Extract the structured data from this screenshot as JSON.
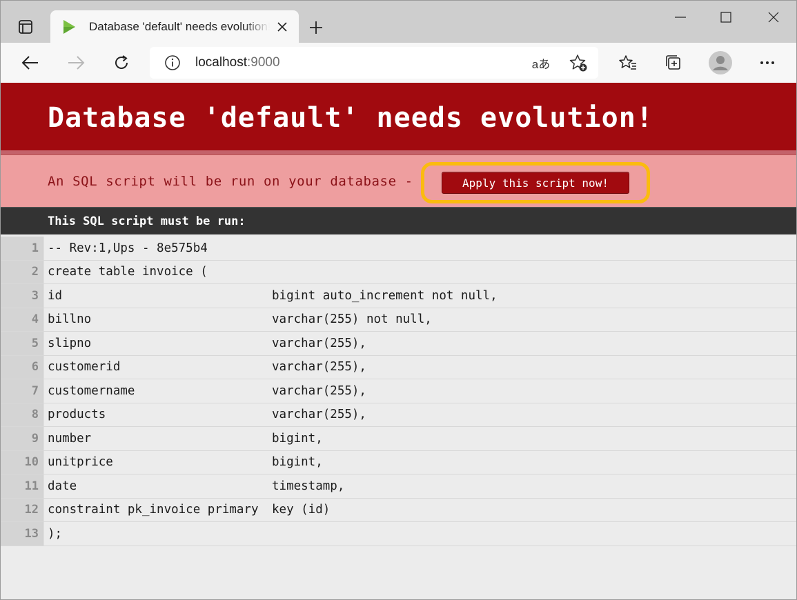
{
  "browser": {
    "tab_title": "Database 'default' needs evolution!",
    "url_host": "localhost",
    "url_port": ":9000",
    "read_aloud_label": "aあ"
  },
  "page": {
    "title": "Database 'default' needs evolution!",
    "subtitle": "An SQL script will be run on your database -",
    "apply_button": "Apply this script now!",
    "script_header": "This SQL script must be run:",
    "lines": [
      {
        "n": "1",
        "a": "-- Rev:1,Ups - 8e575b4",
        "b": ""
      },
      {
        "n": "2",
        "a": "create table invoice (",
        "b": ""
      },
      {
        "n": "3",
        "a": "id",
        "b": "bigint auto_increment not null,"
      },
      {
        "n": "4",
        "a": "billno",
        "b": "varchar(255) not null,"
      },
      {
        "n": "5",
        "a": "slipno",
        "b": "varchar(255),"
      },
      {
        "n": "6",
        "a": "customerid",
        "b": "varchar(255),"
      },
      {
        "n": "7",
        "a": "customername",
        "b": "varchar(255),"
      },
      {
        "n": "8",
        "a": "products",
        "b": "varchar(255),"
      },
      {
        "n": "9",
        "a": "number",
        "b": "bigint,"
      },
      {
        "n": "10",
        "a": "unitprice",
        "b": "bigint,"
      },
      {
        "n": "11",
        "a": "date",
        "b": "timestamp,"
      },
      {
        "n": "12",
        "a": "constraint pk_invoice primary",
        "b": "key (id)"
      },
      {
        "n": "13",
        "a": ");",
        "b": ""
      }
    ]
  },
  "colors": {
    "header_bg": "#a10a0f",
    "subheader_bg": "#ee9e9f",
    "highlight_ring": "#fbbb0f",
    "script_head_bg": "#333333"
  }
}
